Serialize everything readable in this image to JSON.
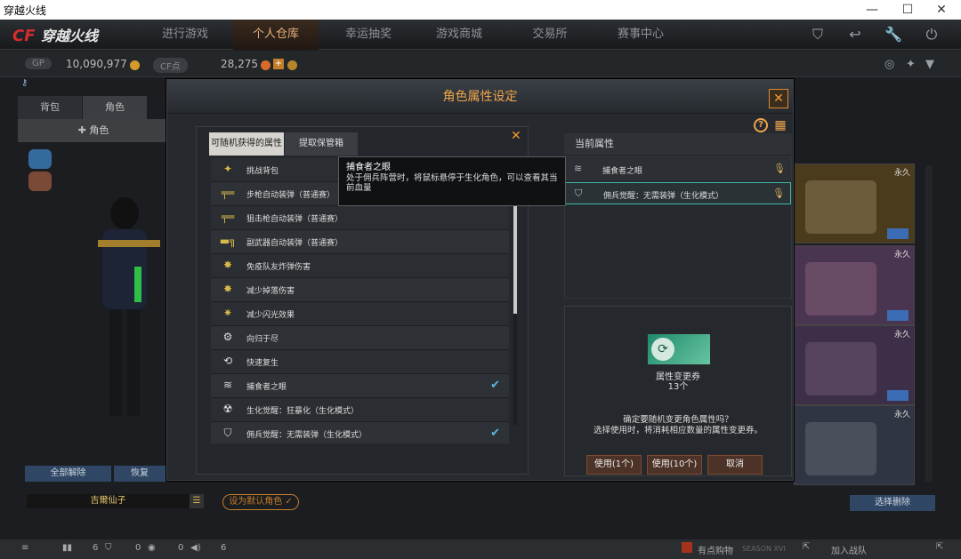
{
  "window": {
    "title": "穿越火线",
    "controls": [
      "—",
      "☐",
      "✕"
    ]
  },
  "nav": {
    "logo": "穿越火线",
    "items": [
      {
        "label": "进行游戏",
        "active": false
      },
      {
        "label": "个人仓库",
        "active": true
      },
      {
        "label": "幸运抽奖",
        "active": false
      },
      {
        "label": "游戏商城",
        "active": false
      },
      {
        "label": "交易所",
        "active": false
      },
      {
        "label": "赛事中心",
        "active": false
      }
    ]
  },
  "currency": {
    "gp_label": "GP",
    "gp_value": "10,090,977",
    "cf_label": "CF点",
    "cf_value": "28,275"
  },
  "left_panel": {
    "tabs": [
      "背包",
      "角色"
    ],
    "role_label": "角色",
    "btn_unequip_all": "全部解除",
    "btn_restore": "恢复",
    "character_name": "吉爾仙子",
    "btn_set_default": "设为默认角色"
  },
  "right_column": {
    "cards": [
      {
        "label": "永久"
      },
      {
        "label": "永久"
      },
      {
        "label": "永久"
      },
      {
        "label": "永久"
      }
    ],
    "btn_select_delete": "选择删除"
  },
  "status_bar": {
    "c1": "6",
    "c2": "0",
    "c3": "0",
    "c4": "6",
    "buy": "有点购物",
    "join": "加入战队",
    "season": "SEASON XVI"
  },
  "modal": {
    "title": "角色属性设定",
    "tabs": {
      "random": "可随机获得的属性",
      "vault": "提取保管箱"
    },
    "attributes": [
      {
        "label": "挑战背包",
        "checked": false,
        "icon": "backpack-icon"
      },
      {
        "label": "步枪自动装弹（普通赛）",
        "checked": false,
        "icon": "rifle-icon"
      },
      {
        "label": "狙击枪自动装弹（普通赛）",
        "checked": false,
        "icon": "sniper-icon"
      },
      {
        "label": "副武器自动装弹（普通赛）",
        "checked": false,
        "icon": "pistol-icon"
      },
      {
        "label": "免疫队友炸弹伤害",
        "checked": false,
        "icon": "explosion-icon"
      },
      {
        "label": "减少掉落伤害",
        "checked": false,
        "icon": "fall-icon"
      },
      {
        "label": "减少闪光效果",
        "checked": false,
        "icon": "flash-icon"
      },
      {
        "label": "向归于尽",
        "checked": false,
        "icon": "gear-bomb-icon"
      },
      {
        "label": "快速复生",
        "checked": false,
        "icon": "respawn-icon"
      },
      {
        "label": "捕食者之眼",
        "checked": true,
        "icon": "claw-icon"
      },
      {
        "label": "生化觉醒：狂暴化（生化模式）",
        "checked": false,
        "icon": "bio-icon"
      },
      {
        "label": "佣兵觉醒：无需装弹（生化模式）",
        "checked": true,
        "icon": "shield-icon"
      }
    ],
    "tooltip": {
      "title": "捕食者之眼",
      "desc": "处于佣兵阵营时，将鼠标悬停于生化角色，可以查看其当前血量"
    },
    "current": {
      "title": "当前属性",
      "items": [
        {
          "label": "捕食者之眼",
          "selected": false
        },
        {
          "label": "佣兵觉醒：无需装弹（生化模式）",
          "selected": true
        }
      ]
    },
    "ticket": {
      "name": "属性变更券",
      "count": "13个"
    },
    "confirm_line1": "确定要随机变更角色属性吗？",
    "confirm_line2": "选择使用时，将消耗相应数量的属性变更券。",
    "buttons": {
      "use1": "使用(1个)",
      "use10": "使用(10个)",
      "cancel": "取消"
    }
  }
}
